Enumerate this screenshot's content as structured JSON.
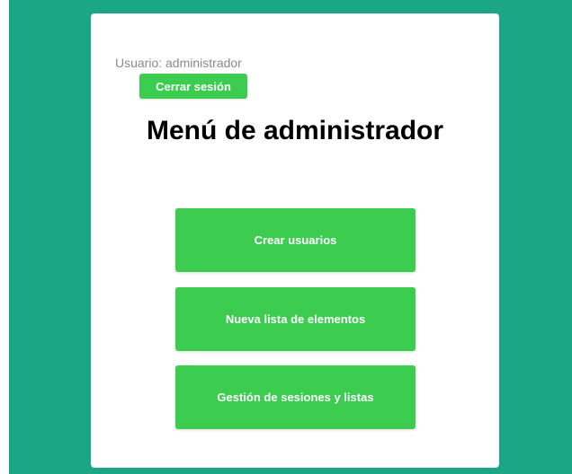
{
  "header": {
    "user_label": "Usuario: administrador",
    "logout_label": "Cerrar sesión"
  },
  "main": {
    "title": "Menú de administrador",
    "buttons": [
      {
        "label": "Crear usuarios"
      },
      {
        "label": "Nueva lista de elementos"
      },
      {
        "label": "Gestión de sesiones y listas"
      }
    ]
  },
  "colors": {
    "background": "#1ba785",
    "card": "#ffffff",
    "button": "#3bcc50",
    "button_text": "#ffffff",
    "user_label": "#8a8a8a"
  }
}
